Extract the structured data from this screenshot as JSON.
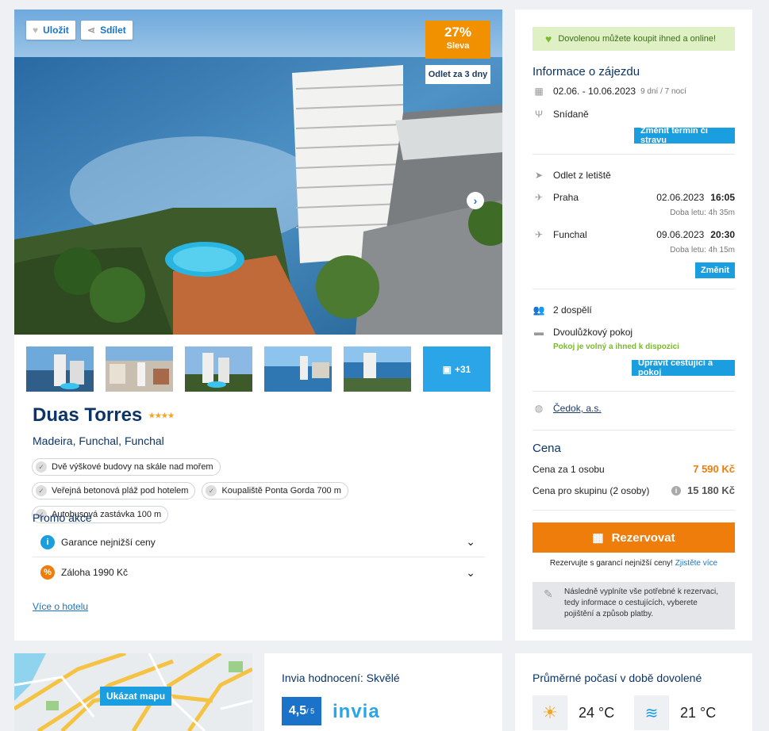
{
  "hotel": {
    "save_label": "Uložit",
    "share_label": "Sdílet",
    "discount_pct": "27%",
    "discount_label": "Sleva",
    "departure_badge": "Odlet za 3 dny",
    "more_photos": "+31",
    "name": "Duas Torres",
    "stars": "★★★★",
    "location": "Madeira, Funchal, Funchal",
    "tags": [
      "Dvě výškové budovy na skále nad mořem",
      "Veřejná betonová pláž pod hotelem",
      "Koupaliště Ponta Gorda 700 m",
      "Autobusová zastávka 100 m"
    ],
    "promo_title": "Promo akce",
    "promos": [
      {
        "label": "Garance nejnižší ceny",
        "icon": "i",
        "color": "#1a9ee0"
      },
      {
        "label": "Záloha 1990 Kč",
        "icon": "%",
        "color": "#ee7d0c"
      }
    ],
    "more_link": "Více o hotelu"
  },
  "info": {
    "banner": "Dovolenou můžete koupit ihned a online!",
    "title": "Informace o zájezdu",
    "dates": "02.06. - 10.06.2023",
    "duration": "9 dní / 7 nocí",
    "board": "Snídaně",
    "change_term_btn": "Změnit termín či stravu",
    "flight_title": "Odlet z letiště",
    "out_city": "Praha",
    "out_date": "02.06.2023",
    "out_time": "16:05",
    "out_duration": "Doba letu: 4h 35m",
    "back_city": "Funchal",
    "back_date": "09.06.2023",
    "back_time": "20:30",
    "back_duration": "Doba letu: 4h 15m",
    "change_btn": "Změnit",
    "travellers": "2 dospělí",
    "room": "Dvoulůžkový pokoj",
    "room_status": "Pokoj je volný a ihned k dispozici",
    "edit_btn": "Upravit cestující a pokoj",
    "operator": "Čedok, a.s.",
    "price_title": "Cena",
    "price_person_label": "Cena za 1 osobu",
    "price_person": "7 590 Kč",
    "price_group_label": "Cena pro skupinu (2 osoby)",
    "price_group": "15 180 Kč",
    "reserve_btn": "Rezervovat",
    "guarantee_text": "Rezervujte s garancí nejnižší ceny!",
    "guarantee_link": "Zjistěte více",
    "note": "Následně vyplníte vše potřebné k rezervaci, tedy informace o cestujících, vyberete pojištění a způsob platby."
  },
  "map": {
    "button": "Ukázat mapu"
  },
  "rating": {
    "title": "Invia hodnocení: Skvělé",
    "score": "4,5",
    "score_max": "/ 5",
    "brand": "invia"
  },
  "weather": {
    "title": "Průměrné počasí v době dovolené",
    "air_temp": "24 °C",
    "water_temp": "21 °C"
  },
  "colors": {
    "accent": "#1a9ee0",
    "orange": "#ee7d0c",
    "navy": "#0c3565",
    "green": "#7cb82f"
  }
}
